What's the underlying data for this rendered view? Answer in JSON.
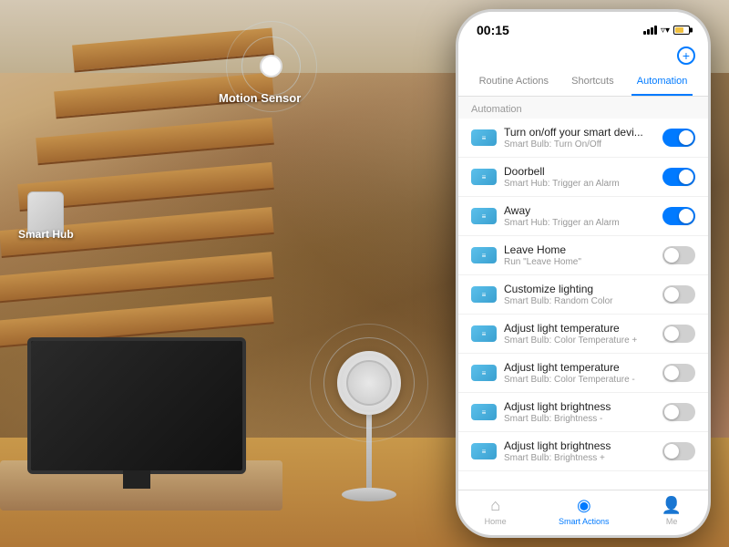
{
  "background": {
    "labels": {
      "motion_sensor": "Motion Sensor",
      "smart_hub": "Smart Hub"
    }
  },
  "phone": {
    "status_bar": {
      "time": "00:15",
      "add_label": "+"
    },
    "tabs": [
      {
        "id": "routine",
        "label": "Routine Actions",
        "active": false
      },
      {
        "id": "shortcuts",
        "label": "Shortcuts",
        "active": false
      },
      {
        "id": "automation",
        "label": "Automation",
        "active": true
      }
    ],
    "section_label": "Automation",
    "automation_items": [
      {
        "id": "1",
        "title": "Turn on/off your smart devi...",
        "subtitle": "Smart Bulb: Turn On/Off",
        "toggle": "on"
      },
      {
        "id": "2",
        "title": "Doorbell",
        "subtitle": "Smart Hub: Trigger an Alarm",
        "toggle": "on"
      },
      {
        "id": "3",
        "title": "Away",
        "subtitle": "Smart Hub: Trigger an Alarm",
        "toggle": "on"
      },
      {
        "id": "4",
        "title": "Leave Home",
        "subtitle": "Run \"Leave Home\"",
        "toggle": "off"
      },
      {
        "id": "5",
        "title": "Customize lighting",
        "subtitle": "Smart Bulb: Random Color",
        "toggle": "off"
      },
      {
        "id": "6",
        "title": "Adjust light temperature",
        "subtitle": "Smart Bulb: Color Temperature +",
        "toggle": "off"
      },
      {
        "id": "7",
        "title": "Adjust light temperature",
        "subtitle": "Smart Bulb: Color Temperature -",
        "toggle": "off"
      },
      {
        "id": "8",
        "title": "Adjust light brightness",
        "subtitle": "Smart Bulb: Brightness -",
        "toggle": "off"
      },
      {
        "id": "9",
        "title": "Adjust light brightness",
        "subtitle": "Smart Bulb: Brightness +",
        "toggle": "off"
      }
    ],
    "bottom_nav": [
      {
        "id": "home",
        "icon": "⌂",
        "label": "Home",
        "active": false
      },
      {
        "id": "smart-actions",
        "icon": "◎",
        "label": "Smart Actions",
        "active": true
      },
      {
        "id": "me",
        "icon": "👤",
        "label": "Me",
        "active": false
      }
    ]
  }
}
